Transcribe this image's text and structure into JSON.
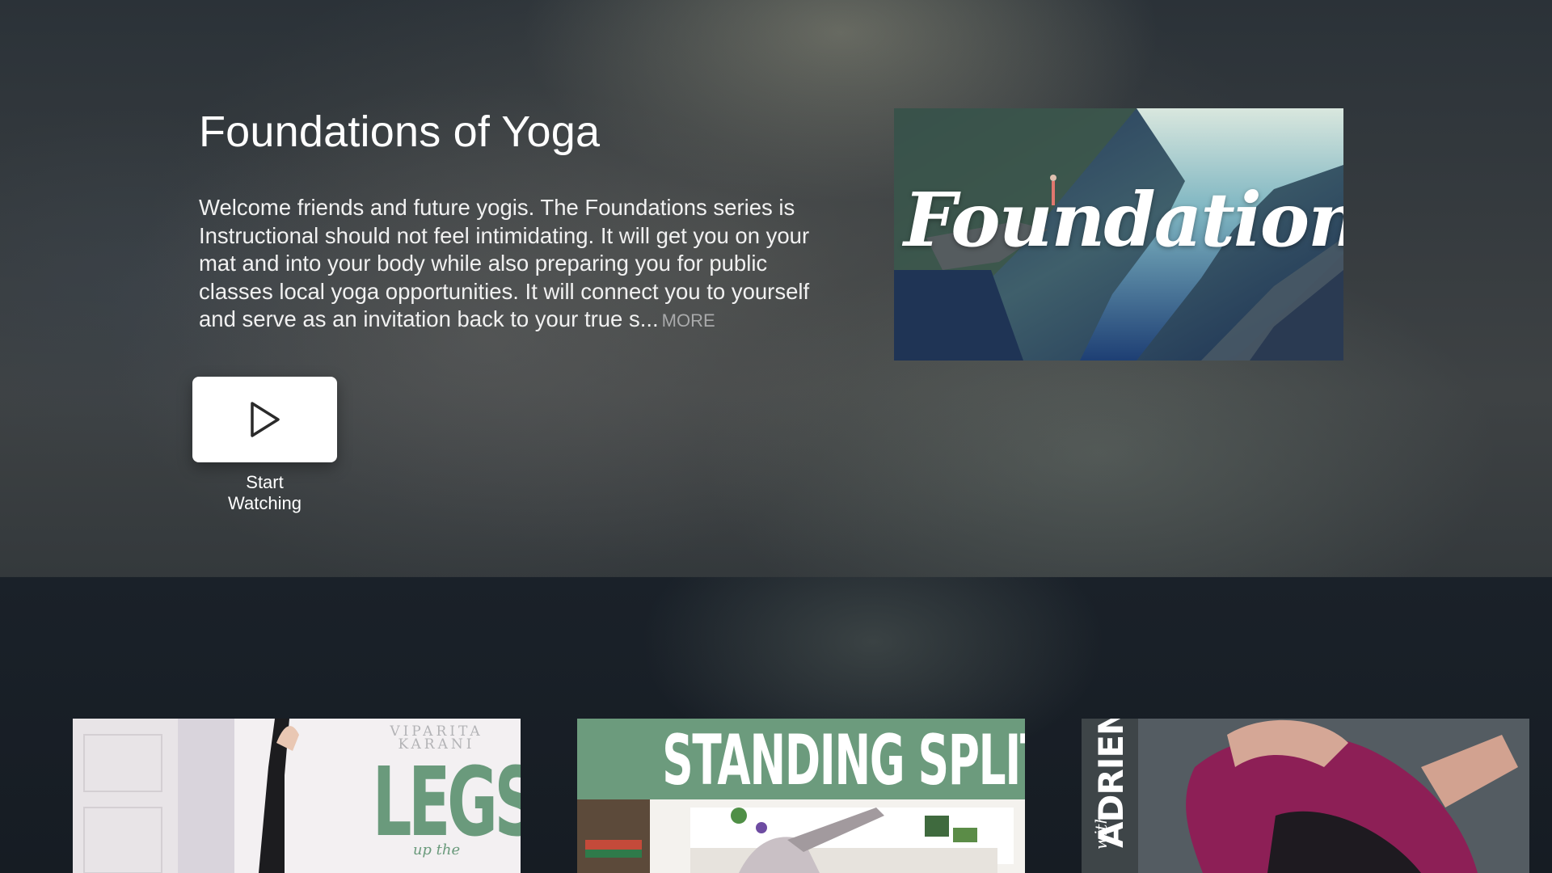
{
  "hero": {
    "title": "Foundations of Yoga",
    "description": "Welcome friends and future yogis. The Foundations series is Instructional should not feel intimidating. It will get you on your mat and into your body while also preparing you for public classes local yoga opportunities. It will connect you to yourself and serve as an invitation back to your true s...",
    "more_label": "MORE",
    "poster_text": "Foundations",
    "play_icon": "play-icon",
    "start_label_line1": "Start",
    "start_label_line2": "Watching"
  },
  "shelf": {
    "items": [
      {
        "label_top": "VIPARITA",
        "label_mid": "KARANI",
        "label_main": "LEGS",
        "label_sub": "up the",
        "accent": "#6a9a7c"
      },
      {
        "label_main": "STANDING SPLITS",
        "accent": "#6c9b7d"
      },
      {
        "label_prefix": "with",
        "label_main": "ADRIENE",
        "accent": "#8d1f56"
      }
    ]
  }
}
